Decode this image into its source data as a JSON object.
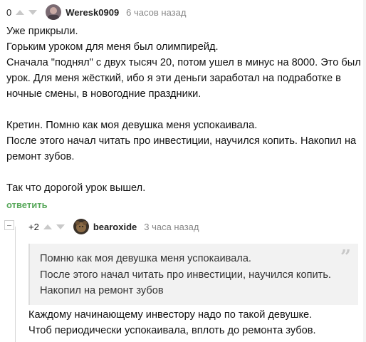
{
  "comment1": {
    "rating": "0",
    "username": "Weresk0909",
    "time": "6 часов назад",
    "lines": [
      "Уже прикрыли.",
      "Горьким уроком для меня был олимпирейд.",
      "Сначала \"поднял\" с двух тысяч 20, потом ушел в минус на 8000. Это был",
      "урок. Для меня жёсткий, ибо я эти деньги заработал на подработке в",
      "ночные смены, в новогодние праздники.",
      "",
      "Кретин. Помню как моя девушка меня успокаивала.",
      "После этого начал читать про инвестиции, научился копить. Накопил на",
      "ремонт зубов.",
      "",
      "Так что дорогой урок вышел."
    ],
    "reply_label": "ответить"
  },
  "comment2": {
    "rating": "+2",
    "username": "bearoxide",
    "time": "3 часа назад",
    "quote_lines": [
      "Помню как моя девушка меня успокаивала.",
      "После этого начал читать про инвестиции, научился копить.",
      "Накопил на ремонт зубов"
    ],
    "quote_mark": "”",
    "lines": [
      "Каждому начинающему инвестору надо по такой девушке.",
      "Чтоб периодически успокаивала, вплоть до ремонта зубов."
    ]
  },
  "colors": {
    "accent_green": "#57a85a",
    "meta_gray": "#888888",
    "quote_bg": "#f2f2f2"
  },
  "icons": [
    "upvote-icon",
    "downvote-icon",
    "avatar",
    "collapse-icon",
    "quote-icon"
  ]
}
